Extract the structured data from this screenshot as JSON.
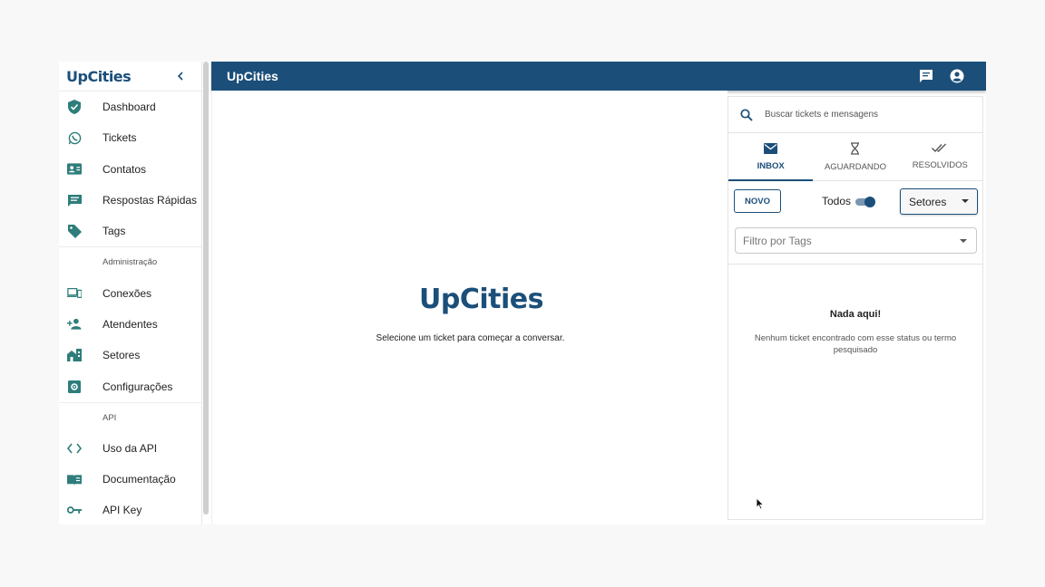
{
  "sidebar": {
    "logo": "UpCities",
    "collapse_icon": "chevron-left-icon",
    "items": [
      {
        "label": "Dashboard",
        "icon": "shield-check-icon"
      },
      {
        "label": "Tickets",
        "icon": "whatsapp-icon"
      },
      {
        "label": "Contatos",
        "icon": "contact-card-icon"
      },
      {
        "label": "Respostas Rápidas",
        "icon": "quick-reply-icon"
      },
      {
        "label": "Tags",
        "icon": "tag-icon"
      }
    ],
    "section_admin": "Administração",
    "admin_items": [
      {
        "label": "Conexões",
        "icon": "devices-icon"
      },
      {
        "label": "Atendentes",
        "icon": "person-add-icon"
      },
      {
        "label": "Setores",
        "icon": "building-icon"
      },
      {
        "label": "Configurações",
        "icon": "settings-icon"
      }
    ],
    "section_api": "API",
    "api_items": [
      {
        "label": "Uso da API",
        "icon": "code-icon"
      },
      {
        "label": "Documentação",
        "icon": "book-icon"
      },
      {
        "label": "API Key",
        "icon": "key-icon"
      }
    ]
  },
  "topbar": {
    "title": "UpCities",
    "icons": [
      "chat-icon",
      "account-circle-icon"
    ]
  },
  "main": {
    "logo": "UpCities",
    "message": "Selecione um ticket para começar a conversar."
  },
  "tickets": {
    "search_placeholder": "Buscar tickets e mensagens",
    "tabs": [
      {
        "label": "INBOX",
        "icon": "mail-icon",
        "active": true
      },
      {
        "label": "AGUARDANDO",
        "icon": "hourglass-icon",
        "active": false
      },
      {
        "label": "RESOLVIDOS",
        "icon": "done-all-icon",
        "active": false
      }
    ],
    "new_button": "NOVO",
    "todos_label": "Todos",
    "todos_on": true,
    "sectors_select": "Setores",
    "tags_filter_placeholder": "Filtro por Tags",
    "empty_title": "Nada aqui!",
    "empty_text": "Nenhum ticket encontrado com esse status ou termo pesquisado"
  },
  "colors": {
    "primary": "#1b4f7a",
    "accent_icon": "#2e7d7b"
  }
}
